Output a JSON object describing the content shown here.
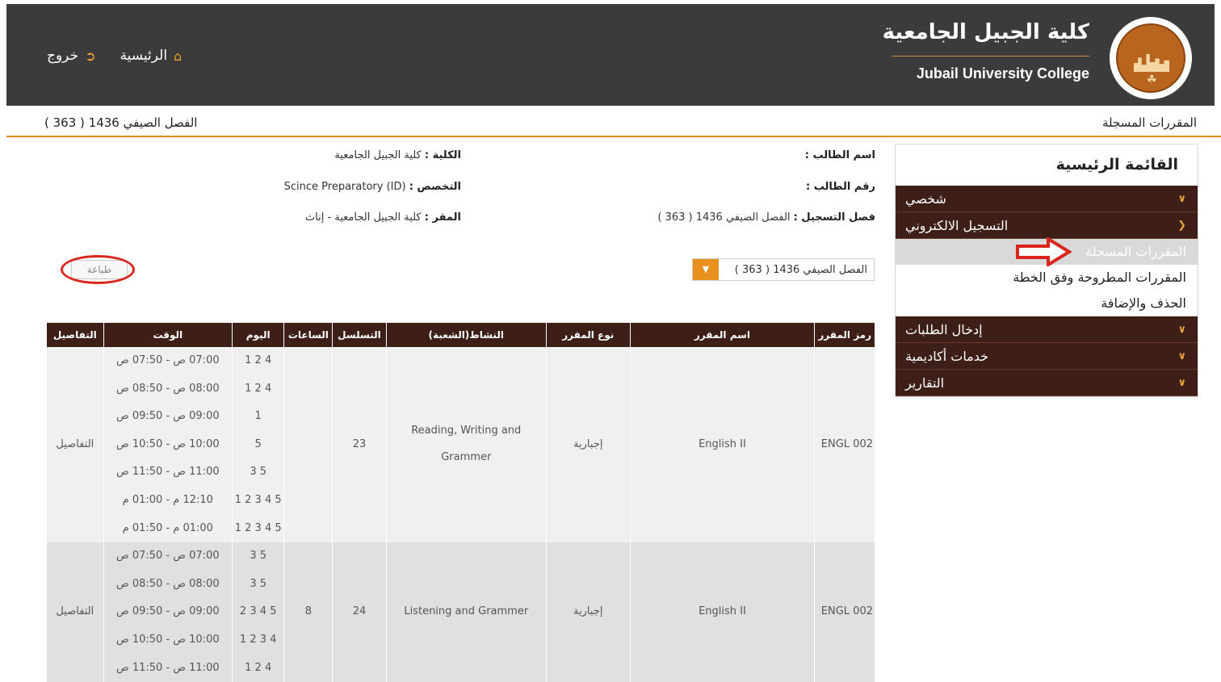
{
  "header": {
    "brand_ar": "كلية الجبيل الجامعية",
    "brand_en": "Jubail University College",
    "nav": {
      "home": "الرئيسية",
      "logout": "خروج"
    }
  },
  "subheader": {
    "page_title": "المقررات المسجلة",
    "semester_text": "الفصل الصيفي 1436 ( 363 )"
  },
  "sidebar": {
    "title": "القائمة الرئيسية",
    "sections": [
      {
        "label": "شخصي",
        "chevron": "down"
      },
      {
        "label": "التسجيل الالكتروني",
        "chevron": "right"
      }
    ],
    "sub_items": [
      {
        "label": "المقررات المسجلة",
        "active": true
      },
      {
        "label": "المقررات المطروحة وفق الخطة",
        "active": false
      },
      {
        "label": "الحذف والإضافة",
        "active": false
      }
    ],
    "sections_after": [
      {
        "label": "إدخال الطلبات"
      },
      {
        "label": "خدمات أكاديمية"
      },
      {
        "label": "التقارير"
      }
    ]
  },
  "student_info": {
    "name_label": "اسم الطالب :",
    "id_label": "رقم الطالب :",
    "reg_label": "فصل التسجيل :",
    "reg_value": "الفصل الصيفي 1436 ( 363 )",
    "college_label": "الكلية :",
    "college_value": "كلية الجبيل الجامعية",
    "major_label": "التخصص :",
    "major_value": "Scince Preparatory (ID)",
    "campus_label": "المقر :",
    "campus_value": "كلية الجبيل الجامعية - إناث"
  },
  "semester_select": {
    "value": "الفصل الصيفي 1436 ( 363 )"
  },
  "print_button": "طباعة",
  "table": {
    "headers": [
      "رمز المقرر",
      "اسم المقرر",
      "نوع المقرر",
      "النشاط(الشعبة)",
      "التسلسل",
      "الساعات",
      "اليوم",
      "الوقت",
      "التفاصيل"
    ],
    "rows": [
      {
        "code": "ENGL 002",
        "name": "English II",
        "type": "إجبارية",
        "activity": "Reading, Writing and Grammer",
        "seq": "23",
        "hours": "",
        "details": "التفاصيل",
        "schedule": [
          {
            "day": "4 2 1",
            "time": "07:00 ص - 07:50 ص"
          },
          {
            "day": "4 2 1",
            "time": "08:00 ص - 08:50 ص"
          },
          {
            "day": "1",
            "time": "09:00 ص - 09:50 ص"
          },
          {
            "day": "5",
            "time": "10:00 ص - 10:50 ص"
          },
          {
            "day": "5 3",
            "time": "11:00 ص - 11:50 ص"
          },
          {
            "day": "5 4 3 2 1",
            "time": "12:10 م - 01:00 م"
          },
          {
            "day": "5 4 3 2 1",
            "time": "01:00 م - 01:50 م"
          }
        ]
      },
      {
        "code": "ENGL 002",
        "name": "English II",
        "type": "إجبارية",
        "activity": "Listening and Grammer",
        "seq": "24",
        "hours": "8",
        "details": "التفاصيل",
        "schedule": [
          {
            "day": "5 3",
            "time": "07:00 ص - 07:50 ص"
          },
          {
            "day": "5 3",
            "time": "08:00 ص - 08:50 ص"
          },
          {
            "day": "5 4 3 2",
            "time": "09:00 ص - 09:50 ص"
          },
          {
            "day": "4 3 2 1",
            "time": "10:00 ص - 10:50 ص"
          },
          {
            "day": "4 2 1",
            "time": "11:00 ص - 11:50 ص"
          }
        ]
      }
    ]
  },
  "colors": {
    "header_bg": "#3b3b3b",
    "accent": "#e08c1e",
    "menu_bg": "#3d1f18",
    "annotation": "#d9261c"
  },
  "icons": {
    "home": "home-icon",
    "logout": "logout-icon",
    "chevron": "chevron-icon"
  }
}
